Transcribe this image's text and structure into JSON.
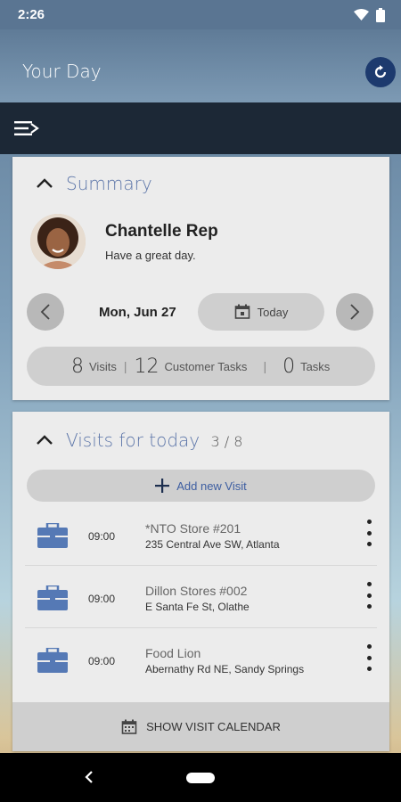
{
  "status_bar": {
    "time": "2:26"
  },
  "header": {
    "title": "Your Day"
  },
  "summary": {
    "heading": "Summary",
    "user_name": "Chantelle Rep",
    "greeting": "Have a great day.",
    "date": "Mon, Jun 27",
    "today_label": "Today",
    "stats": [
      {
        "value": "8",
        "label": "Visits"
      },
      {
        "value": "12",
        "label": "Customer Tasks"
      },
      {
        "value": "0",
        "label": "Tasks"
      }
    ]
  },
  "visits": {
    "heading": "Visits for today",
    "count": "3 / 8",
    "add_label": "Add new Visit",
    "items": [
      {
        "time": "09:00",
        "name": "*NTO Store #201",
        "address": "235 Central Ave SW, Atlanta"
      },
      {
        "time": "09:00",
        "name": "Dillon Stores #002",
        "address": "E Santa Fe St, Olathe"
      },
      {
        "time": "09:00",
        "name": "Food Lion",
        "address": "Abernathy Rd NE, Sandy Springs"
      }
    ],
    "calendar_label": "SHOW VISIT CALENDAR"
  },
  "colors": {
    "accent": "#5d76a9",
    "toolbar": "#1c2836",
    "icon_blue": "#5579b5"
  },
  "icons": [
    "wifi-icon",
    "battery-icon",
    "refresh-icon",
    "menu-icon",
    "chevron-up-icon",
    "chevron-left-icon",
    "chevron-right-icon",
    "calendar-icon",
    "plus-icon",
    "briefcase-icon",
    "more-vert-icon",
    "back-icon"
  ]
}
